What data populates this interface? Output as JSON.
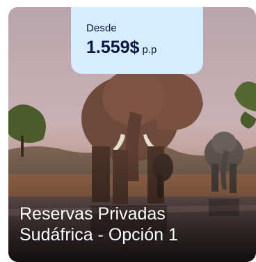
{
  "card": {
    "price_from_label": "Desde",
    "price_amount": "1.559$",
    "price_unit": "p.p",
    "title_line1": "Reservas Privadas",
    "title_line2": "Sudáfrica - Opción 1",
    "image_subject": "elephants-at-waterhole",
    "colors": {
      "badge_bg": "#d6ecff",
      "badge_text": "#0a1540",
      "title_text": "#ffffff"
    }
  }
}
